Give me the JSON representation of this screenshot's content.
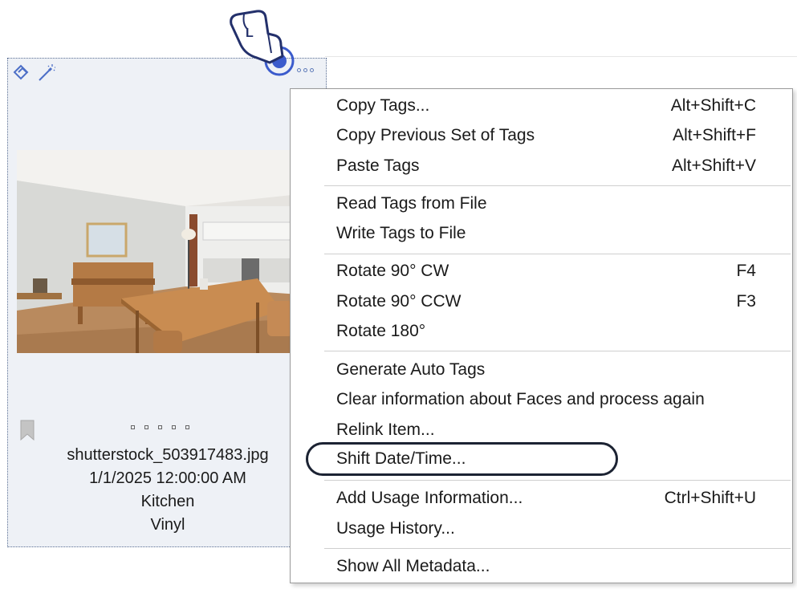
{
  "thumbnail": {
    "filename": "shutterstock_503917483.jpg",
    "date": "1/1/2025 12:00:00 AM",
    "tag1": "Kitchen",
    "tag2": "Vinyl",
    "pointer_badge": "L"
  },
  "menu": {
    "copy_tags": {
      "label": "Copy Tags...",
      "shortcut": "Alt+Shift+C"
    },
    "copy_prev": {
      "label": "Copy Previous Set of Tags",
      "shortcut": "Alt+Shift+F"
    },
    "paste_tags": {
      "label": "Paste Tags",
      "shortcut": "Alt+Shift+V"
    },
    "read_tags": {
      "label": "Read Tags from File"
    },
    "write_tags": {
      "label": "Write Tags to File"
    },
    "rotate_cw": {
      "label": "Rotate 90° CW",
      "shortcut": "F4"
    },
    "rotate_ccw": {
      "label": "Rotate 90° CCW",
      "shortcut": "F3"
    },
    "rotate_180": {
      "label": "Rotate 180°"
    },
    "auto_tags": {
      "label": "Generate Auto Tags"
    },
    "clear_faces": {
      "label": "Clear information about Faces and process again"
    },
    "relink": {
      "label": "Relink Item..."
    },
    "shift_date": {
      "label": "Shift Date/Time..."
    },
    "usage_info": {
      "label": "Add Usage Information...",
      "shortcut": "Ctrl+Shift+U"
    },
    "usage_history": {
      "label": "Usage History..."
    },
    "show_metadata": {
      "label": "Show All Metadata..."
    }
  },
  "colors": {
    "card_bg": "#eef1f6",
    "accent": "#3b5bcc",
    "highlight_ring": "#1c2333"
  }
}
